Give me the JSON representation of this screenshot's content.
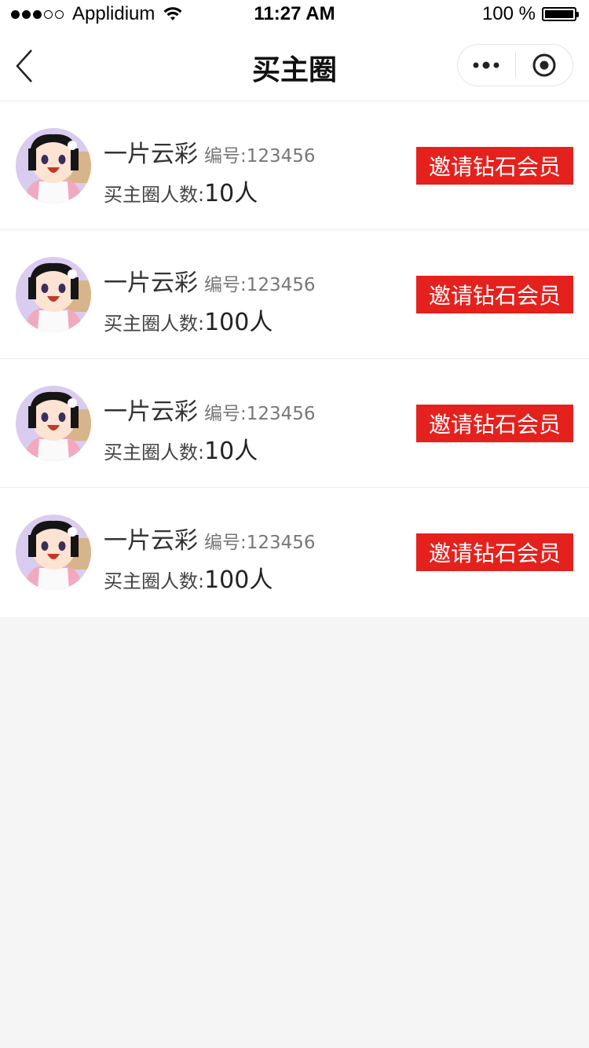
{
  "status_bar": {
    "carrier": "Applidium",
    "time": "11:27 AM",
    "battery": "100 %"
  },
  "nav": {
    "title": "买主圈"
  },
  "colors": {
    "accent": "#e5211d",
    "background": "#f5f5f5"
  },
  "members": [
    {
      "name": "一片云彩",
      "id_label": "编号:123456",
      "count_label": "买主圈人数:",
      "count_value": "10人",
      "button_label": "邀请钻石会员"
    },
    {
      "name": "一片云彩",
      "id_label": "编号:123456",
      "count_label": "买主圈人数:",
      "count_value": "100人",
      "button_label": "邀请钻石会员"
    },
    {
      "name": "一片云彩",
      "id_label": "编号:123456",
      "count_label": "买主圈人数:",
      "count_value": "10人",
      "button_label": "邀请钻石会员"
    },
    {
      "name": "一片云彩",
      "id_label": "编号:123456",
      "count_label": "买主圈人数:",
      "count_value": "100人",
      "button_label": "邀请钻石会员"
    }
  ]
}
